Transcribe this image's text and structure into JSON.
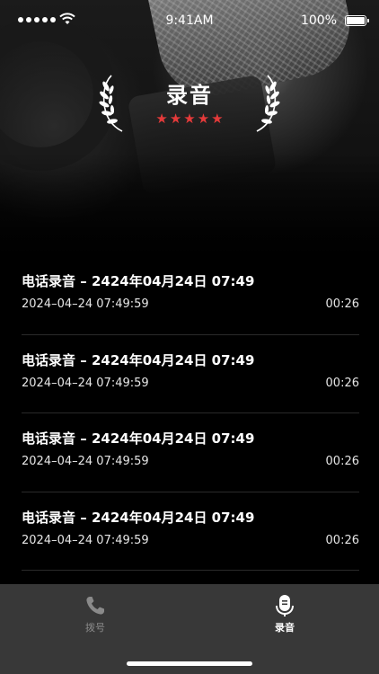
{
  "status_bar": {
    "time": "9:41AM",
    "battery": "100%",
    "icons": [
      "signal-dots-icon",
      "wifi-icon",
      "battery-icon"
    ]
  },
  "header": {
    "title": "录音",
    "rating": 5,
    "star_color": "#e43a3a"
  },
  "recordings": [
    {
      "title": "电话录音 – 2424年04月24日 07:49",
      "date": "2024–04–24 07:49:59",
      "duration": "00:26"
    },
    {
      "title": "电话录音 – 2424年04月24日 07:49",
      "date": "2024–04–24 07:49:59",
      "duration": "00:26"
    },
    {
      "title": "电话录音 – 2424年04月24日 07:49",
      "date": "2024–04–24 07:49:59",
      "duration": "00:26"
    },
    {
      "title": "电话录音 – 2424年04月24日 07:49",
      "date": "2024–04–24 07:49:59",
      "duration": "00:26"
    }
  ],
  "tab_bar": {
    "tabs": [
      {
        "label": "拨号",
        "icon": "phone-icon",
        "active": false
      },
      {
        "label": "录音",
        "icon": "microphone-icon",
        "active": true
      }
    ],
    "background": "#383838"
  }
}
